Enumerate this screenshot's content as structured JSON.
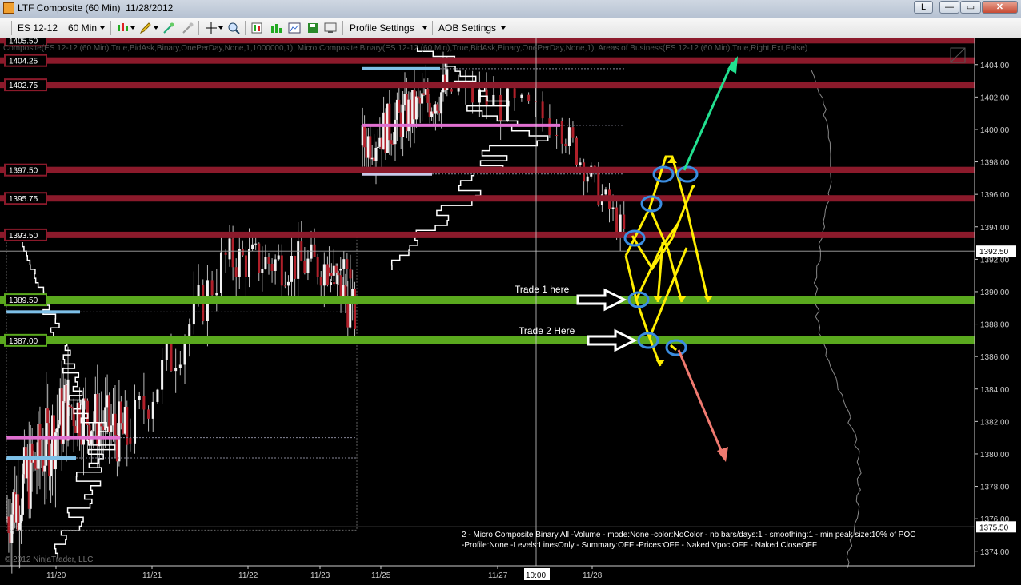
{
  "window": {
    "title": "LTF Composite (60 Min)  11/28/2012",
    "link_label": "L",
    "minimize_label": "—",
    "maximize_label": "▭",
    "close_label": "✕"
  },
  "toolbar": {
    "instrument": "ES 12-12",
    "interval": "60 Min",
    "profile_settings": "Profile Settings",
    "aob_settings": "AOB Settings",
    "icons": [
      "candlestick-icon",
      "pencil-icon",
      "wand-icon",
      "crosshair-icon",
      "zoom-icon",
      "properties-icon",
      "bar-chart-icon",
      "chart-window-icon",
      "save-icon",
      "display-icon"
    ]
  },
  "indicator_label": "Composite(ES 12-12 (60 Min),True,BidAsk,Binary,OnePerDay,None,1,1000000,1), Micro Composite Binary(ES 12-12 (60 Min),True,BidAsk,Binary,OnePerDay,None,1), Areas of Business(ES 12-12 (60 Min),True,Right,Ext,False)",
  "settings_text": {
    "line1": "2 - Micro Composite Binary All -Volume - mode:None -color:NoColor - nb bars/days:1 - smoothing:1 - min peak size:10% of POC",
    "line2": "-Profile:None -Levels:LinesOnly - Summary:OFF -Prices:OFF - Naked Vpoc:OFF - Naked CloseOFF"
  },
  "copyright": "© 2012 NinjaTrader, LLC",
  "annotations": {
    "trade1": "Trade 1 here",
    "trade2": "Trade 2 Here"
  },
  "colors": {
    "resistance": "#8b1a2b",
    "support": "#5aa81e",
    "vpoc": "#e070d0",
    "value": "#7ec0e8",
    "arrow_up": "#22e090",
    "arrow_down": "#f07a70",
    "path": "#ffee00",
    "circle": "#3b8de0",
    "last_price": "#ffffff"
  },
  "chart_data": {
    "type": "candlestick",
    "x_tick_labels": [
      "11/20",
      "11/21",
      "11/22",
      "11/23",
      "11/25",
      "11/27",
      "10:00",
      "11/28"
    ],
    "y_ticks": [
      1404.0,
      1402.0,
      1400.0,
      1398.0,
      1396.0,
      1394.0,
      1392.0,
      1390.0,
      1388.0,
      1386.0,
      1384.0,
      1382.0,
      1380.0,
      1378.0,
      1376.0,
      1374.0
    ],
    "y_range": [
      1373.5,
      1405.6
    ],
    "last_price": 1392.5,
    "last_price_label": "1392.50",
    "lower_price_label": "1375.50",
    "crosshair_time_label": "10:00",
    "resistance_levels": [
      {
        "price": 1405.5,
        "label": "1405.50"
      },
      {
        "price": 1404.25,
        "label": "1404.25"
      },
      {
        "price": 1402.75,
        "label": "1402.75"
      },
      {
        "price": 1397.5,
        "label": "1397.50"
      },
      {
        "price": 1395.75,
        "label": "1395.75"
      },
      {
        "price": 1393.5,
        "label": "1393.50"
      }
    ],
    "support_levels": [
      {
        "price": 1389.5,
        "label": "1389.50"
      },
      {
        "price": 1387.0,
        "label": "1387.00"
      }
    ],
    "candle_segments": [
      {
        "start": 1376.0,
        "end": 1383.0,
        "count": 40,
        "vol": 2.4
      },
      {
        "start": 1383.0,
        "end": 1381.0,
        "count": 30,
        "vol": 2.0
      },
      {
        "start": 1381.0,
        "end": 1392.0,
        "count": 22,
        "vol": 1.6
      },
      {
        "start": 1392.0,
        "end": 1391.5,
        "count": 38,
        "vol": 1.4
      },
      {
        "start": 1391.5,
        "end": 1388.5,
        "count": 12,
        "vol": 1.5
      },
      {
        "start": 1399.0,
        "end": 1402.5,
        "count": 45,
        "vol": 1.5
      },
      {
        "start": 1402.5,
        "end": 1400.5,
        "count": 16,
        "vol": 1.2
      },
      {
        "start": 1400.5,
        "end": 1393.5,
        "count": 18,
        "vol": 1.0
      }
    ]
  }
}
